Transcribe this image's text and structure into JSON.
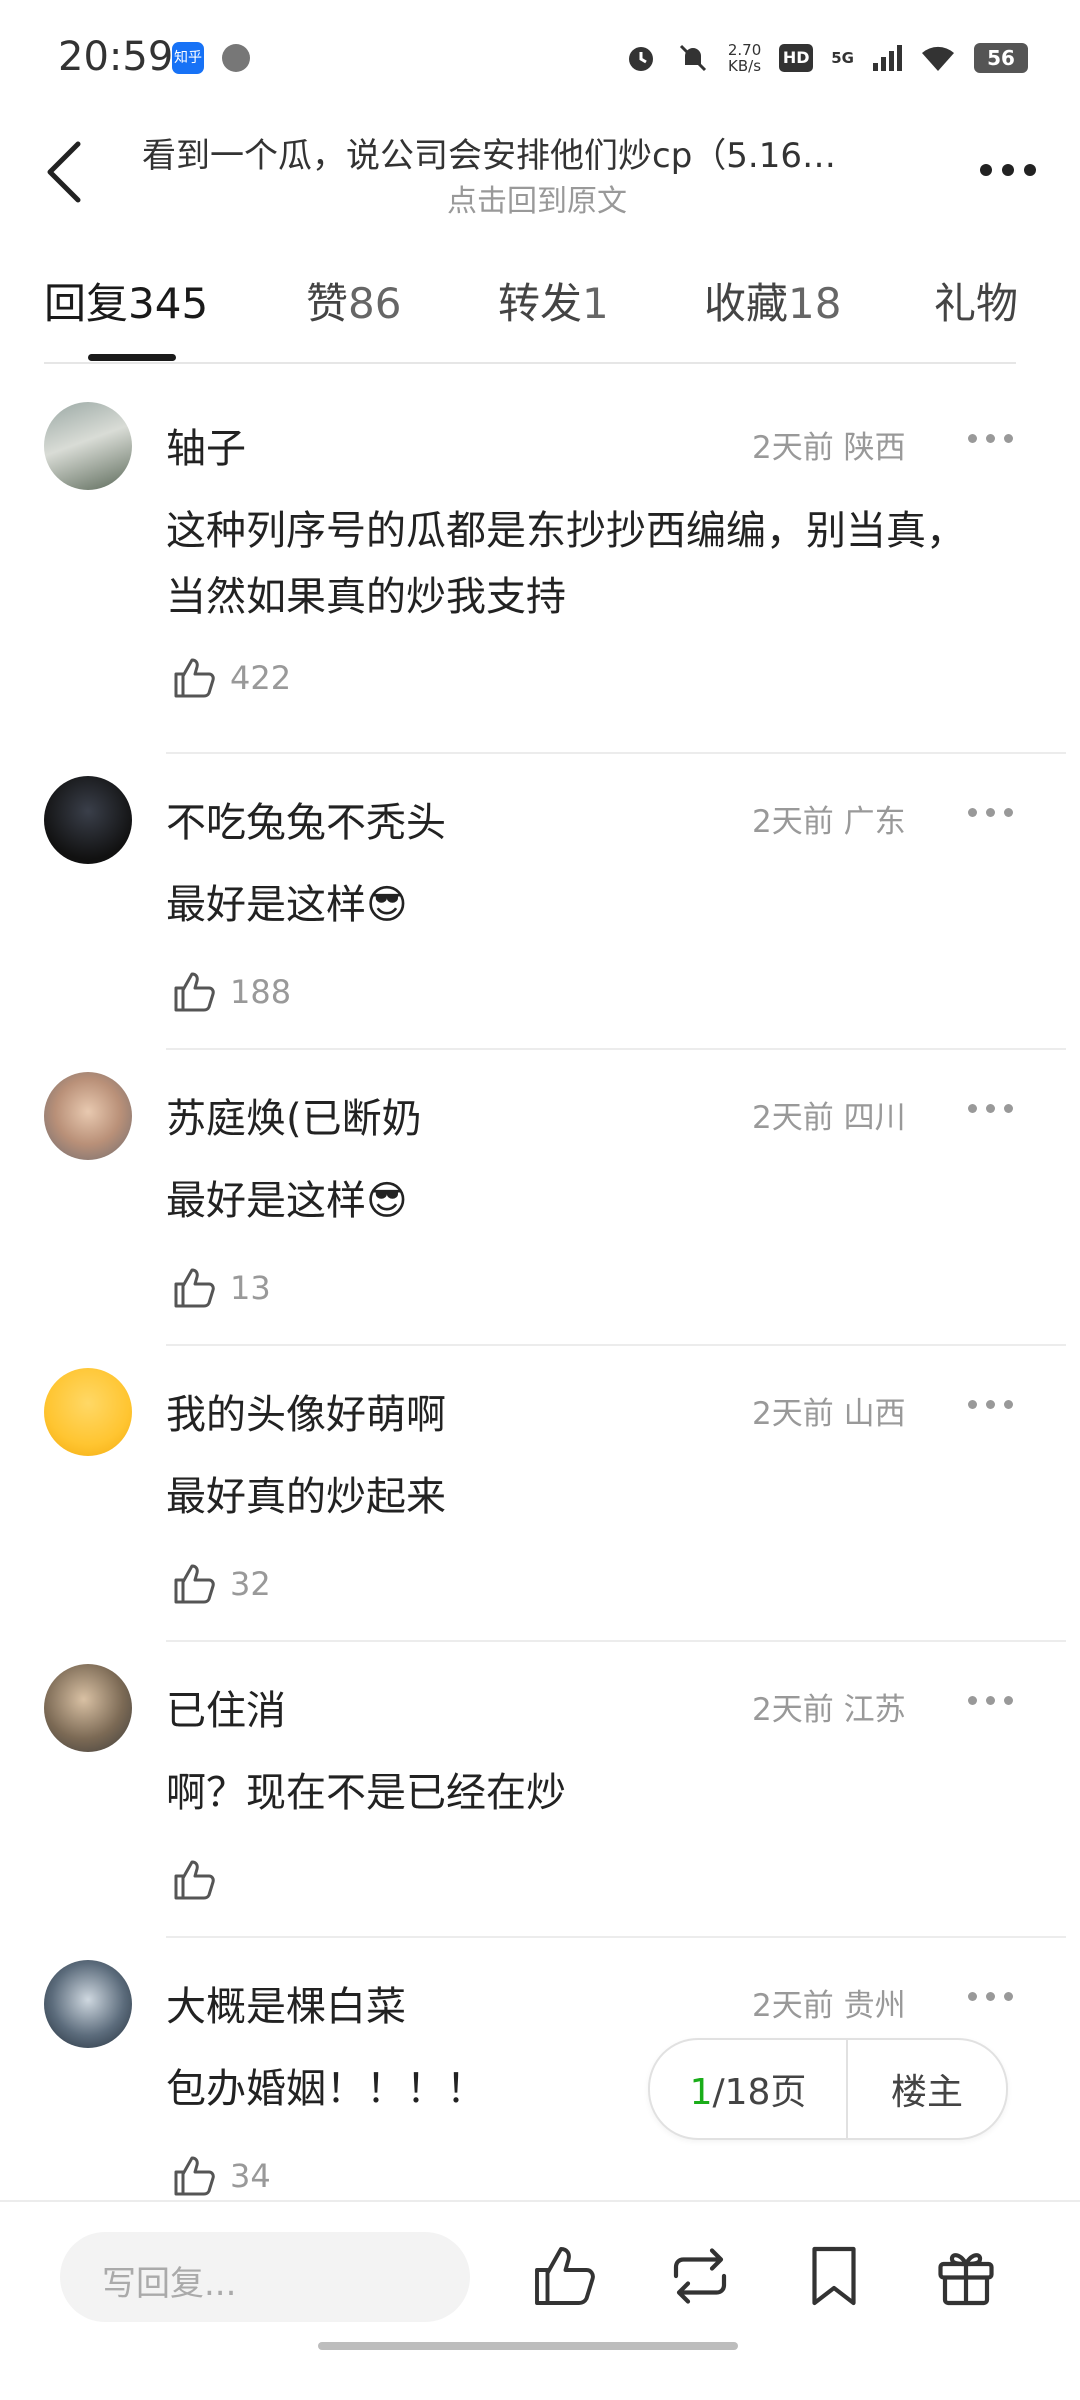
{
  "status_bar": {
    "time": "20:59",
    "zhihu_icon": "知乎",
    "net_speed": "2.70\nKB/s",
    "hd": "HD",
    "network": "5G",
    "battery": "56"
  },
  "header": {
    "title": "看到一个瓜，说公司会安排他们炒cp（5.16…",
    "subtitle": "点击回到原文"
  },
  "tabs": [
    {
      "label": "回复",
      "count": "345"
    },
    {
      "label": "赞",
      "count": "86"
    },
    {
      "label": "转发",
      "count": "1"
    },
    {
      "label": "收藏",
      "count": "18"
    },
    {
      "label": "礼物",
      "count": ""
    }
  ],
  "comments": [
    {
      "name": "轴子",
      "time": "2天前",
      "location": "陕西",
      "text": "这种列序号的瓜都是东抄抄西编编，别当真，当然如果真的炒我支持",
      "likes": "422"
    },
    {
      "name": "不吃兔兔不秃头",
      "time": "2天前",
      "location": "广东",
      "text": "最好是这样😎",
      "likes": "188"
    },
    {
      "name": "苏庭焕(已断奶",
      "time": "2天前",
      "location": "四川",
      "text": "最好是这样😎",
      "likes": "13"
    },
    {
      "name": "我的头像好萌啊",
      "time": "2天前",
      "location": "山西",
      "text": "最好真的炒起来",
      "likes": "32"
    },
    {
      "name": "已住消",
      "time": "2天前",
      "location": "江苏",
      "text": "啊？现在不是已经在炒",
      "likes": ""
    },
    {
      "name": "大概是棵白菜",
      "time": "2天前",
      "location": "贵州",
      "text": "包办婚姻！！！！",
      "likes": "34"
    }
  ],
  "pager": {
    "current": "1",
    "total": "/18页",
    "op_label": "楼主"
  },
  "bottom_bar": {
    "reply_placeholder": "写回复..."
  },
  "icons": {
    "back": "chevron-left-icon",
    "more": "more-dots-icon",
    "like": "thumbs-up-icon",
    "repost": "repost-icon",
    "bookmark": "bookmark-icon",
    "gift": "gift-icon"
  },
  "colors": {
    "accent_green": "#1aad19",
    "zhihu_blue": "#1772f6"
  }
}
